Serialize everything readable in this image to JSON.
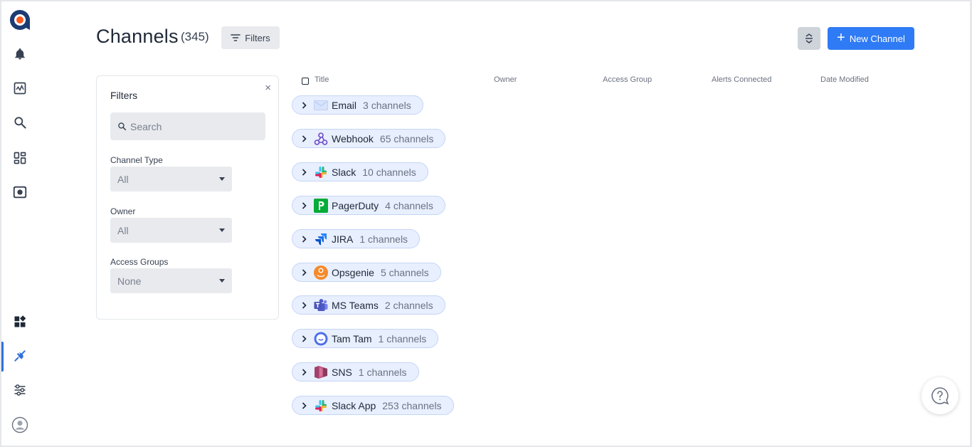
{
  "colors": {
    "accent": "#2f7bf5",
    "group_bg": "#e8efff",
    "group_border": "#c5d5f5"
  },
  "sidebar": {
    "items": [
      {
        "icon": "logo-icon"
      },
      {
        "icon": "bell-icon"
      },
      {
        "icon": "activity-icon"
      },
      {
        "icon": "search-icon"
      },
      {
        "icon": "dashboard-icon"
      },
      {
        "icon": "camera-icon"
      },
      {
        "icon": "widgets-icon"
      },
      {
        "icon": "integration-icon",
        "active": true
      },
      {
        "icon": "settings-sliders-icon"
      },
      {
        "icon": "user-avatar-icon"
      }
    ]
  },
  "header": {
    "title": "Channels",
    "count": "(345)",
    "filters_label": "Filters",
    "new_channel_label": "New Channel"
  },
  "filters": {
    "title": "Filters",
    "close": "×",
    "search_placeholder": "Search",
    "channel_type": {
      "label": "Channel Type",
      "value": "All"
    },
    "owner": {
      "label": "Owner",
      "value": "All"
    },
    "access_groups": {
      "label": "Access Groups",
      "value": "None"
    }
  },
  "table": {
    "columns": [
      "Title",
      "Owner",
      "Access Group",
      "Alerts Connected",
      "Date Modified"
    ]
  },
  "groups": [
    {
      "name": "Email",
      "count": "3 channels",
      "icon": "email-icon"
    },
    {
      "name": "Webhook",
      "count": "65 channels",
      "icon": "webhook-icon"
    },
    {
      "name": "Slack",
      "count": "10 channels",
      "icon": "slack-icon"
    },
    {
      "name": "PagerDuty",
      "count": "4 channels",
      "icon": "pagerduty-icon"
    },
    {
      "name": "JIRA",
      "count": "1 channels",
      "icon": "jira-icon"
    },
    {
      "name": "Opsgenie",
      "count": "5 channels",
      "icon": "opsgenie-icon"
    },
    {
      "name": "MS Teams",
      "count": "2 channels",
      "icon": "msteams-icon"
    },
    {
      "name": "Tam Tam",
      "count": "1 channels",
      "icon": "tamtam-icon"
    },
    {
      "name": "SNS",
      "count": "1 channels",
      "icon": "sns-icon"
    },
    {
      "name": "Slack App",
      "count": "253 channels",
      "icon": "slack-app-icon"
    }
  ]
}
